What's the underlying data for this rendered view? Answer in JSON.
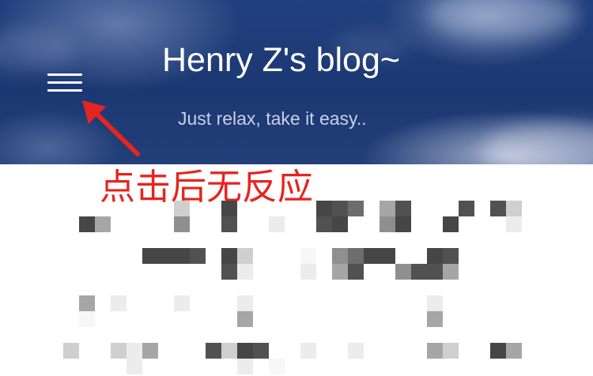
{
  "hero": {
    "title": "Henry Z's blog~",
    "subtitle": "Just relax, take it easy..",
    "background_color": "#1c3873",
    "menu_icon": "hamburger-menu-icon"
  },
  "annotation": {
    "text": "点击后无反应",
    "color": "#e52520",
    "arrow_icon": "red-arrow-icon"
  },
  "obscured_content": {
    "pixel_colors": [
      "#464646",
      "#cfcfcf",
      "#ececec",
      "#8f8f8f",
      "#515151",
      "#a6a6a6",
      "#f7f7f7",
      "#6d6d6d"
    ]
  }
}
